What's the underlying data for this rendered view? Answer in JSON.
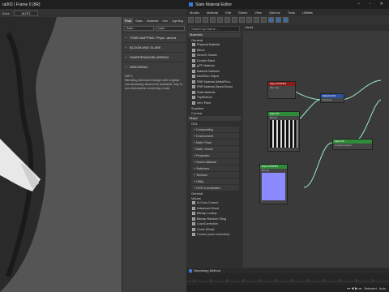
{
  "framebuffer": {
    "title": "ra002 | Frame 0 (8R)",
    "bar": {
      "area_label": "Area",
      "area_value": "AUTO"
    },
    "tabs": [
      "Post",
      "Stats",
      "Material",
      "Info",
      "Lighting"
    ],
    "buttons": {
      "save": "Save...",
      "load": "Load..."
    },
    "sections": [
      "TONE MAPPING: Physi...amera",
      "BLOOM AND GLARE",
      "SHARPENING/BLURRING",
      "DENOISING"
    ],
    "info_heading": "INFO",
    "info_text": "Blending denoised image with original via denoising amount is available only in non-interactive rendering mode."
  },
  "sme": {
    "title": "Slate Material Editor",
    "menu": [
      "Modes",
      "Material",
      "Edit",
      "Select",
      "View",
      "Options",
      "Tools",
      "Utilities"
    ],
    "search_placeholder": "Search by Name ...",
    "view_tab": "View1",
    "groups": {
      "materials": "Materials",
      "general": "General",
      "scanline": "Scanline",
      "corona": "Corona",
      "maps": "Maps",
      "osl": "OSL",
      "general_maps": "General",
      "values": "Values"
    },
    "material_items": [
      "Physical Material",
      "Blend",
      "DirectX Shader",
      "Double Sided",
      "glTF Material",
      "Material Switcher",
      "Multi/Sub-Object",
      "PBR Material (Metal/Rou...",
      "PBR Material (Spec/Gloss)",
      "Shell Material",
      "Top/Bottom",
      "Ink'n Paint"
    ],
    "osl_items": [
      "Compositing",
      "Environment",
      "Math: Float",
      "Math: Vector",
      "Projection",
      "Scene Attribute",
      "Switchers",
      "Textures",
      "Utility",
      "UVW Coordinates"
    ],
    "map_items": [
      "Ai Color Correct",
      "Advanced Wood",
      "Bitmap Lookup",
      "Bitmap Random Tiling",
      "ColorCorrection",
      "Curve (Float)",
      "Curves (color correction)"
    ],
    "nodes": [
      {
        "id": "n1",
        "title": "Map #1758453",
        "sub": "Mix map"
      },
      {
        "id": "n2",
        "title": "Material #21",
        "sub": "Physical"
      },
      {
        "id": "n3",
        "title": "Map #37",
        "sub": "Bitmap"
      },
      {
        "id": "n4",
        "title": "Map #19",
        "sub": "ColorCorrection"
      },
      {
        "id": "n5",
        "title": "Map #1758453",
        "sub": "Bitmap"
      }
    ],
    "status_label": "Rendering Method",
    "bottom": {
      "selected": "Selected",
      "auto": "Auto"
    }
  }
}
